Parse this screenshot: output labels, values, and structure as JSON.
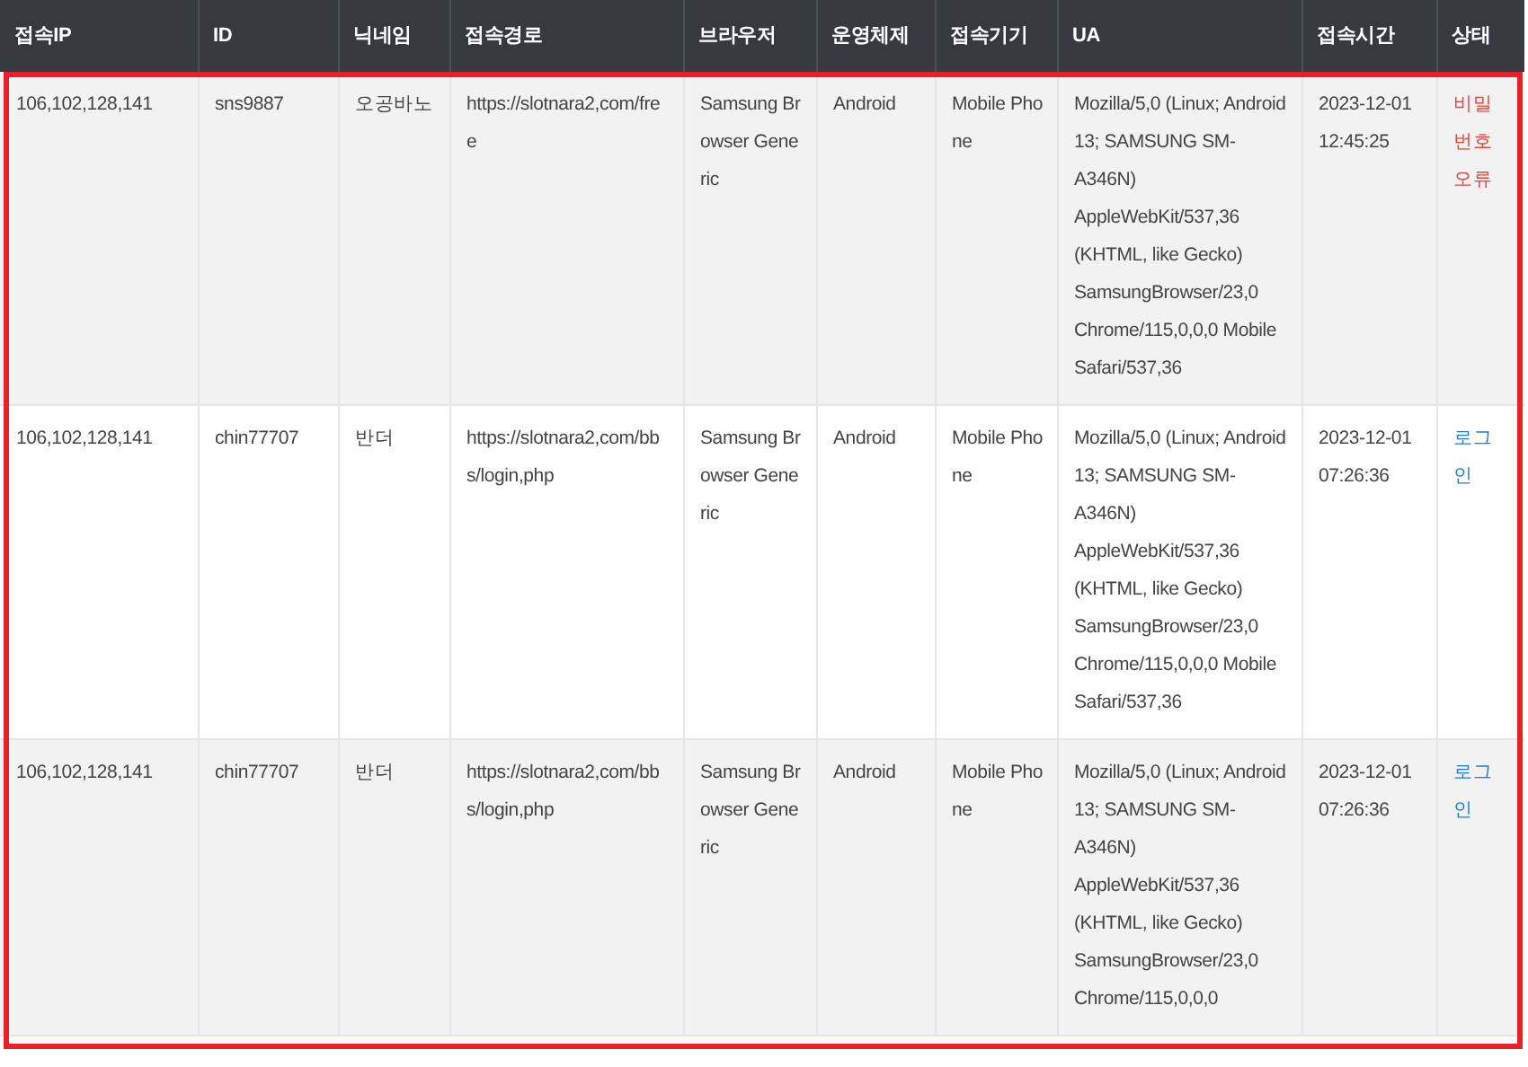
{
  "table": {
    "columns": [
      "접속IP",
      "ID",
      "닉네임",
      "접속경로",
      "브라우저",
      "운영체제",
      "접속기기",
      "UA",
      "접속시간",
      "상태"
    ],
    "rows": [
      {
        "ip": "106,102,128,141",
        "id": "sns9887",
        "nickname": "오공바노",
        "path": "https://slotnara2,com/free",
        "browser": "Samsung Browser Generic",
        "os": "Android",
        "device": "Mobile Phone",
        "ua": "Mozilla/5,0 (Linux; Android 13; SAMSUNG SM-A346N) AppleWebKit/537,36 (KHTML, like Gecko) SamsungBrowser/23,0 Chrome/115,0,0,0 Mobile Safari/537,36",
        "time": "2023-12-01 12:45:25",
        "status": {
          "text": "비밀번호오류",
          "kind": "error"
        }
      },
      {
        "ip": "106,102,128,141",
        "id": "chin77707",
        "nickname": "반더",
        "path": "https://slotnara2,com/bbs/login,php",
        "browser": "Samsung Browser Generic",
        "os": "Android",
        "device": "Mobile Phone",
        "ua": "Mozilla/5,0 (Linux; Android 13; SAMSUNG SM-A346N) AppleWebKit/537,36 (KHTML, like Gecko) SamsungBrowser/23,0 Chrome/115,0,0,0 Mobile Safari/537,36",
        "time": "2023-12-01 07:26:36",
        "status": {
          "text": "로그인",
          "kind": "login"
        }
      },
      {
        "ip": "106,102,128,141",
        "id": "chin77707",
        "nickname": "반더",
        "path": "https://slotnara2,com/bbs/login,php",
        "browser": "Samsung Browser Generic",
        "os": "Android",
        "device": "Mobile Phone",
        "ua": "Mozilla/5,0 (Linux; Android 13; SAMSUNG SM-A346N) AppleWebKit/537,36 (KHTML, like Gecko) SamsungBrowser/23,0 Chrome/115,0,0,0",
        "time": "2023-12-01 07:26:36",
        "status": {
          "text": "로그인",
          "kind": "login"
        }
      }
    ]
  }
}
